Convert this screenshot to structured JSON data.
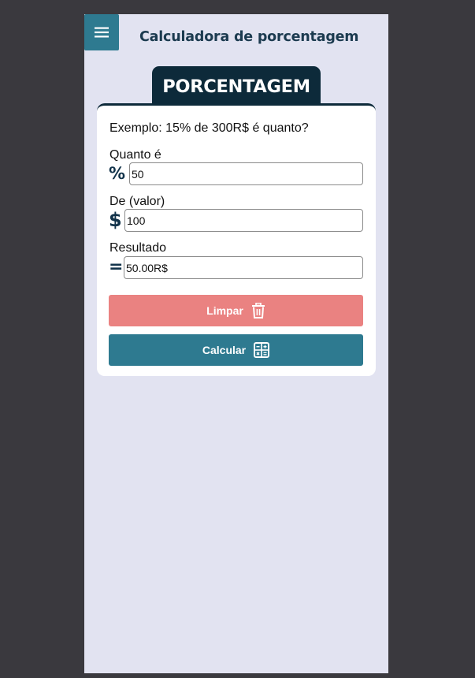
{
  "header": {
    "menu_icon": "hamburger-menu-icon",
    "title": "Calculadora de porcentagem"
  },
  "section": {
    "tab_title": "PORCENTAGEM"
  },
  "form": {
    "example": "Exemplo: 15% de 300R$ é quanto?",
    "percent": {
      "label": "Quanto é",
      "symbol": "%",
      "value": "50"
    },
    "base": {
      "label": "De (valor)",
      "symbol": "$",
      "value": "100"
    },
    "result": {
      "label": "Resultado",
      "symbol": "=",
      "value": "50.00R$"
    }
  },
  "actions": {
    "clear_label": "Limpar",
    "clear_icon": "trash-icon",
    "calc_label": "Calcular",
    "calc_icon": "calculator-icon"
  },
  "colors": {
    "page_bg": "#e2e3f1",
    "accent": "#2e7a90",
    "dark": "#0d2a3a",
    "danger": "#ea8281"
  }
}
